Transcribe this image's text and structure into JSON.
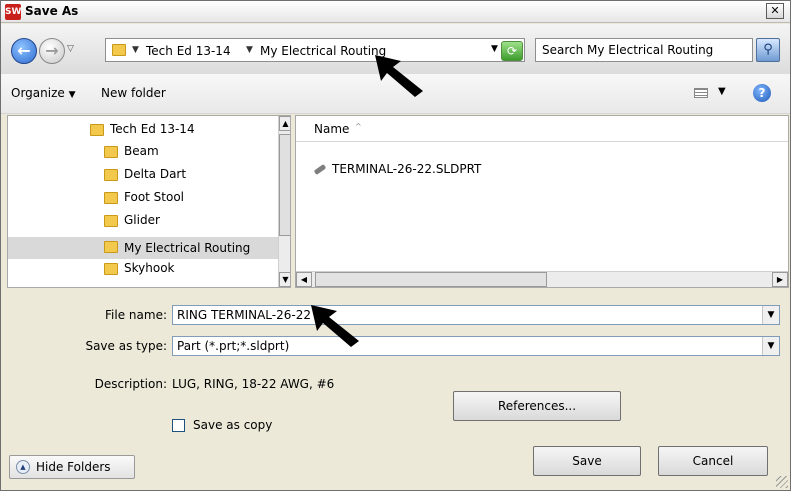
{
  "window": {
    "title": "Save As",
    "app_icon_text": "SW"
  },
  "nav": {
    "breadcrumbs": [
      "Tech Ed 13-14",
      "My Electrical Routing"
    ],
    "search_placeholder": "Search My Electrical Routing"
  },
  "toolbar": {
    "organize_label": "Organize",
    "new_folder_label": "New folder"
  },
  "tree": {
    "items": [
      {
        "label": "Tech Ed 13-14",
        "selected": false
      },
      {
        "label": "Beam",
        "selected": false
      },
      {
        "label": "Delta Dart",
        "selected": false
      },
      {
        "label": "Foot Stool",
        "selected": false
      },
      {
        "label": "Glider",
        "selected": false
      },
      {
        "label": "My Electrical Routing",
        "selected": true
      },
      {
        "label": "Skyhook",
        "selected": false
      }
    ]
  },
  "files": {
    "column_name": "Name",
    "items": [
      {
        "label": "TERMINAL-26-22.SLDPRT"
      }
    ]
  },
  "form": {
    "file_name_label": "File name:",
    "file_name_value": "RING TERMINAL-26-22",
    "save_type_label": "Save as type:",
    "save_type_value": "Part (*.prt;*.sldprt)",
    "description_label": "Description:",
    "description_value": "LUG, RING, 18-22 AWG, #6",
    "references_label": "References...",
    "save_copy_label": "Save as copy"
  },
  "buttons": {
    "hide_folders": "Hide Folders",
    "save": "Save",
    "cancel": "Cancel"
  },
  "colors": {
    "selection": "#d9d9d9",
    "folder": "#f2c94c",
    "annotation_arrow": "#000000"
  }
}
